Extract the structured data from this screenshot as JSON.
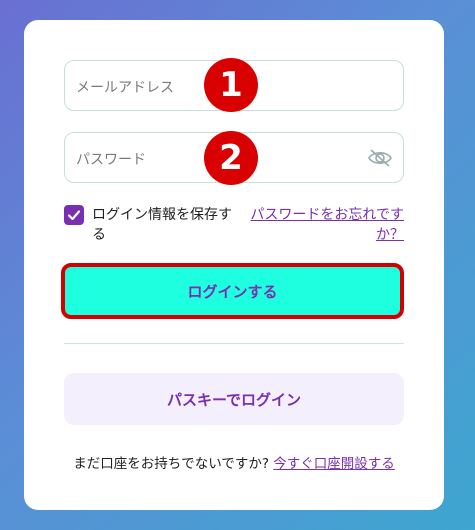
{
  "form": {
    "email_placeholder": "メールアドレス",
    "password_placeholder": "パスワード",
    "badge_1": "1",
    "badge_2": "2",
    "remember_label": "ログイン情報を保存する",
    "remember_checked": true,
    "forgot_link": "パスワードをお忘れですか？",
    "login_button": "ログインする",
    "passkey_button": "パスキーでログイン",
    "signup_prompt": "まだ口座をお持ちでないですか?",
    "signup_link": "今すぐ口座開設する"
  },
  "icons": {
    "password_toggle": "eye-off-icon",
    "checkbox": "checkmark-icon"
  },
  "colors": {
    "accent": "#7a2fb0",
    "login_button_bg": "#1effe0",
    "highlight_red": "#d80000"
  }
}
